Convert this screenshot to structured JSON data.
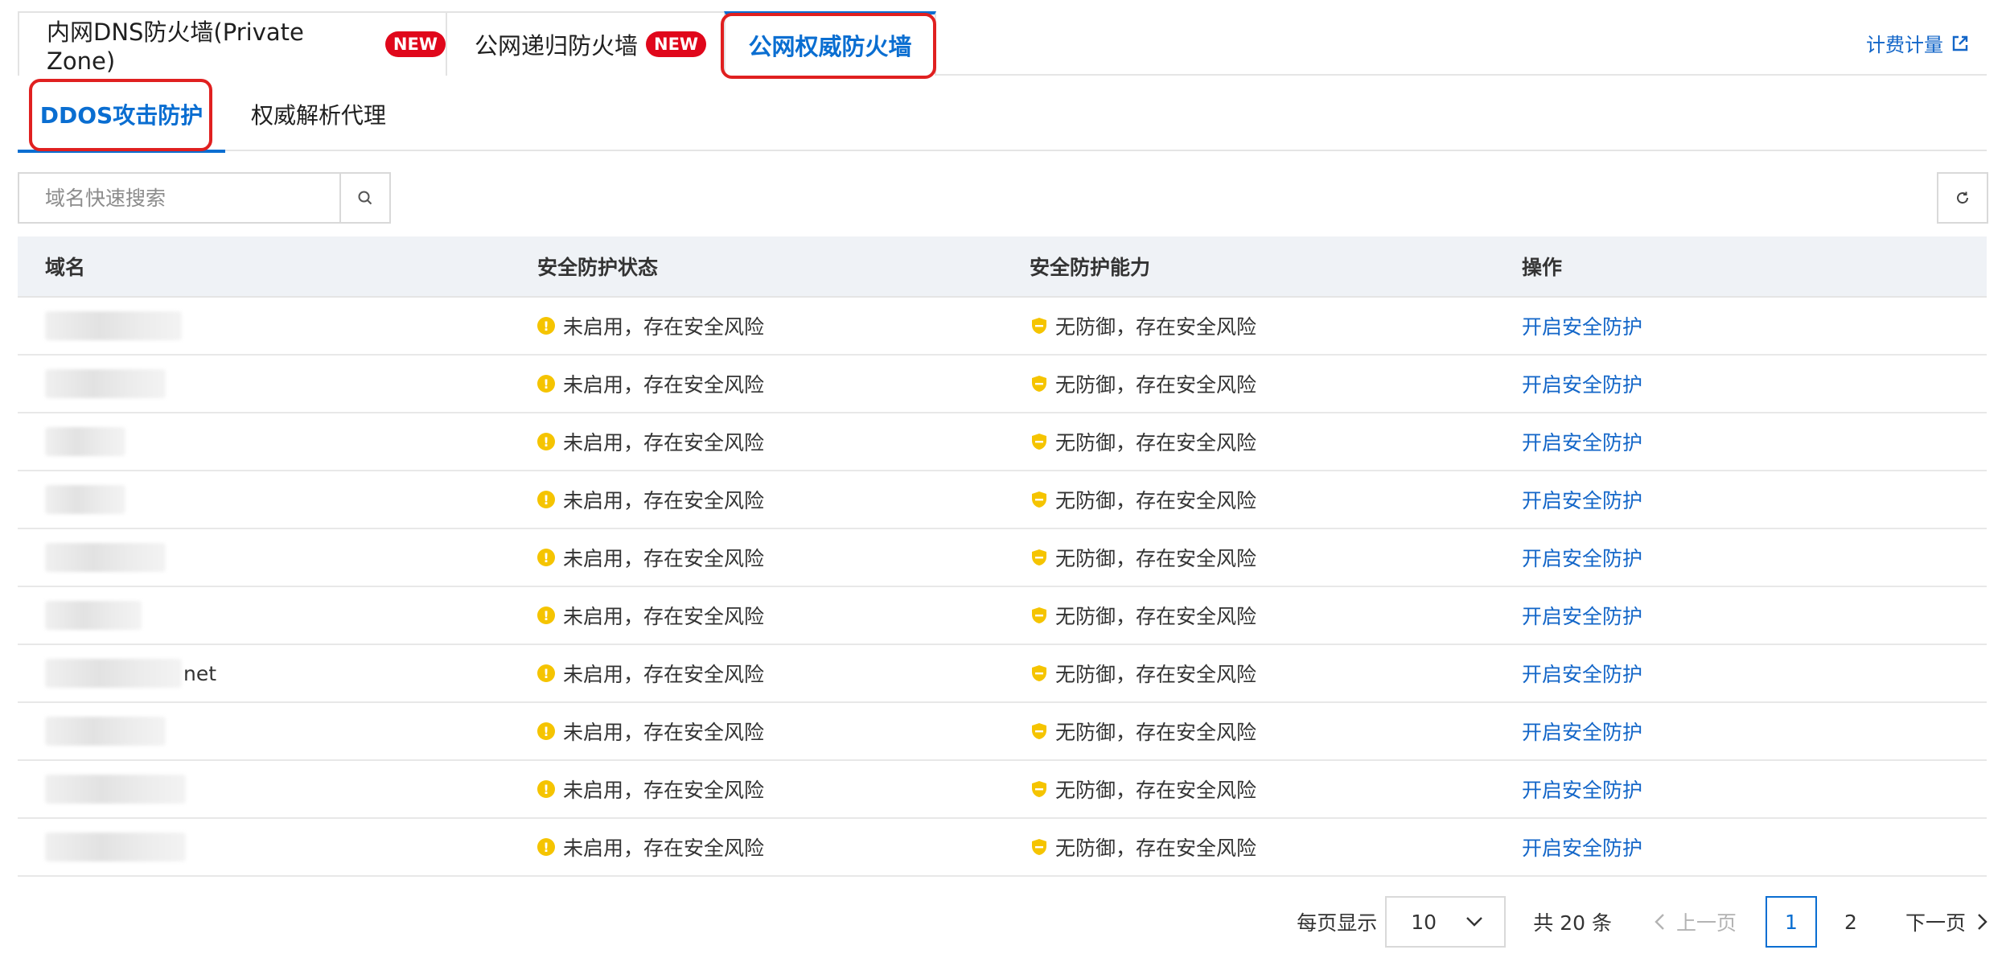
{
  "top_tabs": [
    {
      "label": "内网DNS防火墙(Private Zone)",
      "badge": "NEW"
    },
    {
      "label": "公网递归防火墙",
      "badge": "NEW"
    },
    {
      "label": "公网权威防火墙",
      "badge": ""
    }
  ],
  "billing_link": "计费计量",
  "sub_tabs": [
    {
      "label": "DDOS攻击防护"
    },
    {
      "label": "权威解析代理"
    }
  ],
  "search": {
    "placeholder": "域名快速搜索"
  },
  "table": {
    "headers": [
      "域名",
      "安全防护状态",
      "安全防护能力",
      "操作"
    ],
    "rows": [
      {
        "domain_suffix": "",
        "status": "未启用，存在安全风险",
        "capability": "无防御，存在安全风险",
        "action": "开启安全防护"
      },
      {
        "domain_suffix": "",
        "status": "未启用，存在安全风险",
        "capability": "无防御，存在安全风险",
        "action": "开启安全防护"
      },
      {
        "domain_suffix": "",
        "status": "未启用，存在安全风险",
        "capability": "无防御，存在安全风险",
        "action": "开启安全防护"
      },
      {
        "domain_suffix": "",
        "status": "未启用，存在安全风险",
        "capability": "无防御，存在安全风险",
        "action": "开启安全防护"
      },
      {
        "domain_suffix": "",
        "status": "未启用，存在安全风险",
        "capability": "无防御，存在安全风险",
        "action": "开启安全防护"
      },
      {
        "domain_suffix": "",
        "status": "未启用，存在安全风险",
        "capability": "无防御，存在安全风险",
        "action": "开启安全防护"
      },
      {
        "domain_suffix": "net",
        "status": "未启用，存在安全风险",
        "capability": "无防御，存在安全风险",
        "action": "开启安全防护"
      },
      {
        "domain_suffix": "",
        "status": "未启用，存在安全风险",
        "capability": "无防御，存在安全风险",
        "action": "开启安全防护"
      },
      {
        "domain_suffix": "",
        "status": "未启用，存在安全风险",
        "capability": "无防御，存在安全风险",
        "action": "开启安全防护"
      },
      {
        "domain_suffix": "",
        "status": "未启用，存在安全风险",
        "capability": "无防御，存在安全风险",
        "action": "开启安全防护"
      }
    ]
  },
  "pagination": {
    "page_size_label": "每页显示",
    "page_size": "10",
    "total": "共 20 条",
    "prev": "上一页",
    "pages": [
      "1",
      "2"
    ],
    "next": "下一页"
  },
  "colors": {
    "accent": "#0a6ed1",
    "badge": "#e0071b",
    "warning": "#f5c400",
    "highlight": "#e02020"
  },
  "icons": {
    "warning": "warning-icon",
    "shield": "shield-icon",
    "search": "search-icon",
    "refresh": "refresh-icon",
    "external": "external-link-icon"
  }
}
